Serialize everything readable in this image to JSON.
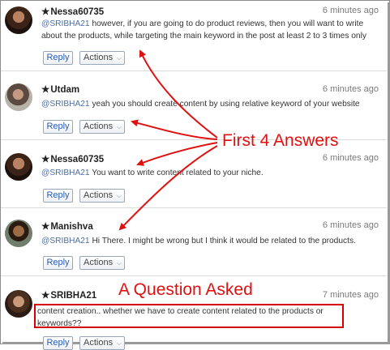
{
  "posts": [
    {
      "username": "Nessa60735",
      "time": "6 minutes ago",
      "mention": "@SRIBHA21",
      "text_line1": " however, if you are going to do product reviews, then you will want to write",
      "text_line2": "about the products, while targeting the main keyword in the post at least 2 to 3 times only",
      "reply": "Reply",
      "actions": "Actions"
    },
    {
      "username": "Utdam",
      "time": "6 minutes ago",
      "mention": "@SRIBHA21",
      "text_line1": " yeah you should create content by using relative keyword of your website",
      "reply": "Reply",
      "actions": "Actions"
    },
    {
      "username": "Nessa60735",
      "time": "6 minutes ago",
      "mention": "@SRIBHA21",
      "text_line1": " You want to write content related to your niche.",
      "reply": "Reply",
      "actions": "Actions"
    },
    {
      "username": "Manishva",
      "time": "6 minutes ago",
      "mention": "@SRIBHA21",
      "text_line1": " Hi There. I might be wrong but I think it would be related to the products.",
      "reply": "Reply",
      "actions": "Actions"
    },
    {
      "username": "SRIBHA21",
      "time": "7 minutes ago",
      "text_line1": "content creation.. whether we have to create content related to the products or",
      "text_line2": "keywords??",
      "reply": "Reply",
      "actions": "Actions"
    }
  ],
  "annotations": {
    "answers_label": "First 4 Answers",
    "question_label": "A Question Asked",
    "color": "#e01010"
  },
  "colors": {
    "mention": "#4a6fa5",
    "reply_link": "#2a5db0",
    "highlight_box": "#d40000"
  }
}
